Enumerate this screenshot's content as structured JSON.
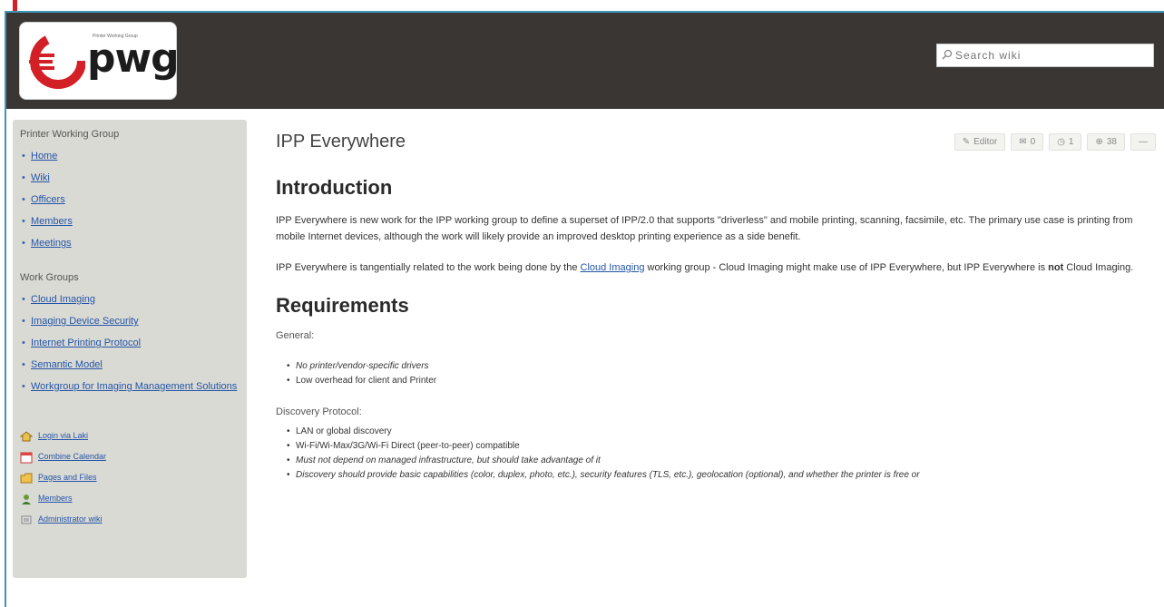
{
  "brand": {
    "logo_text": "pwg",
    "tagline": "Printer Working Group"
  },
  "search": {
    "placeholder": "Search wiki"
  },
  "sidebar": {
    "group_heading": "Printer Working Group",
    "group_links": [
      "Home",
      "Wiki",
      "Officers",
      "Members",
      "Meetings"
    ],
    "work_heading": "Work Groups",
    "work_links": [
      "Cloud Imaging",
      "Imaging Device Security",
      "Internet Printing Protocol",
      "Semantic Model",
      "Workgroup for Imaging Management Solutions"
    ],
    "tools": [
      {
        "label": "Login via Laki",
        "icon": "home-icon"
      },
      {
        "label": "Combine Calendar",
        "icon": "calendar-icon"
      },
      {
        "label": "Pages and Files",
        "icon": "files-icon"
      },
      {
        "label": "Members",
        "icon": "members-icon"
      },
      {
        "label": "Administrator wiki",
        "icon": "admin-icon"
      }
    ]
  },
  "page": {
    "title": "IPP Everywhere",
    "tools": [
      {
        "label": "Editor",
        "icon": "edit-icon"
      },
      {
        "label": "0",
        "icon": "comment-icon"
      },
      {
        "label": "1",
        "icon": "history-icon"
      },
      {
        "label": "38",
        "icon": "globe-icon"
      },
      {
        "label": "—",
        "icon": "menu-icon"
      }
    ],
    "intro_heading": "Introduction",
    "intro_p1": "IPP Everywhere is new work for the IPP working group to define a superset of IPP/2.0 that supports \"driverless\" and mobile printing, scanning, facsimile, etc. The primary use case is printing from mobile Internet devices, although the work will likely provide an improved desktop printing experience as a side benefit.",
    "intro_p2_a": "IPP Everywhere is tangentially related to the work being done by the ",
    "intro_p2_link": "Cloud Imaging",
    "intro_p2_b": " working group - Cloud Imaging might make use of IPP Everywhere, but IPP Everywhere is ",
    "intro_p2_bold": "not",
    "intro_p2_c": " Cloud Imaging.",
    "req_heading": "Requirements",
    "general_label": "General:",
    "general_items": [
      "No printer/vendor-specific drivers",
      "Low overhead for client and Printer"
    ],
    "discovery_label": "Discovery Protocol:",
    "discovery_items": [
      "LAN or global discovery",
      "Wi-Fi/Wi-Max/3G/Wi-Fi Direct (peer-to-peer) compatible",
      "Must not depend on managed infrastructure, but should take advantage of it",
      "Discovery should provide basic capabilities (color, duplex, photo, etc.), security features (TLS, etc.), geolocation (optional), and whether the printer is free or"
    ]
  },
  "colors": {
    "header_bg": "#3a3633",
    "sidebar_bg": "#dadad4",
    "link": "#2455a8",
    "accent": "#d32027",
    "frame": "#3f97b8"
  }
}
